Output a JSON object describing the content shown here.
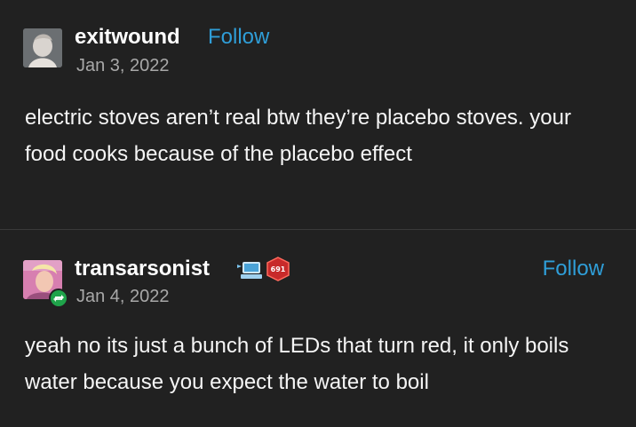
{
  "posts": [
    {
      "username": "exitwound",
      "follow_label": "Follow",
      "date": "Jan 3, 2022",
      "text": "electric stoves aren’t real btw they’re placebo stoves. your food cooks because of the placebo effect"
    },
    {
      "username": "transarsonist",
      "follow_label": "Follow",
      "date": "Jan 4, 2022",
      "badge_label": "691",
      "text": "yeah no its just a bunch of LEDs that turn red, it only boils water because you expect the water to boil"
    }
  ],
  "colors": {
    "background": "#212121",
    "follow": "#2f9ed8",
    "reblog": "#1fa34a"
  }
}
